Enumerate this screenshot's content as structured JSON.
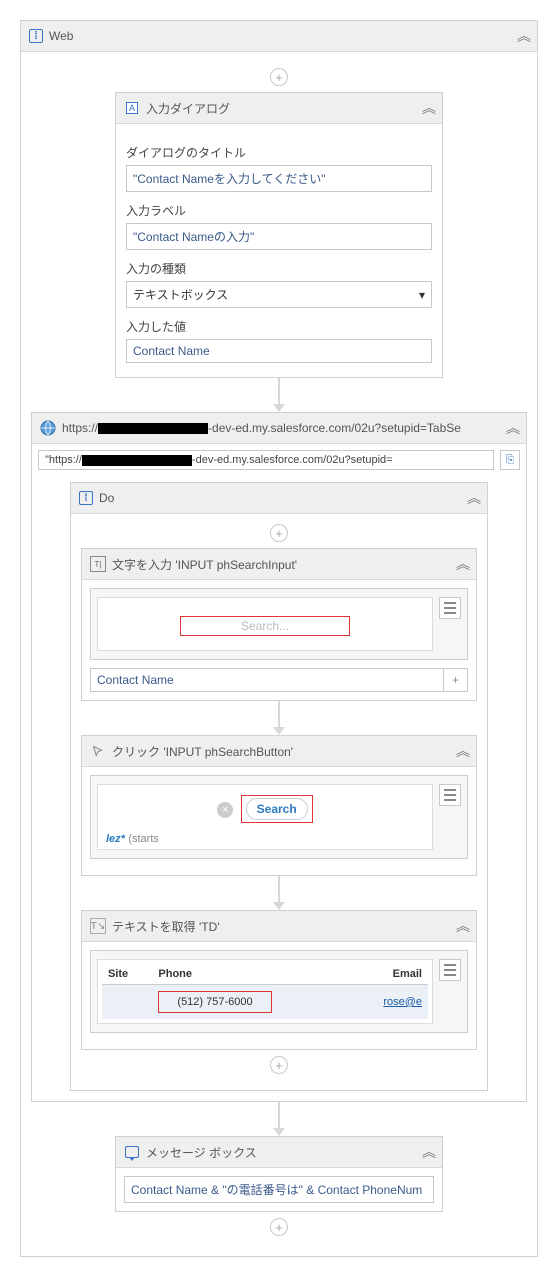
{
  "web": {
    "title": "Web"
  },
  "dialog": {
    "header": "入力ダイアログ",
    "title_label": "ダイアログのタイトル",
    "title_value": "\"Contact Nameを入力してください\"",
    "input_label_label": "入力ラベル",
    "input_label_value": "\"Contact Nameの入力\"",
    "type_label": "入力の種類",
    "type_value": "テキストボックス",
    "entered_label": "入力した値",
    "entered_value": "Contact Name"
  },
  "browser": {
    "header_prefix": "https://",
    "header_suffix": "-dev-ed.my.salesforce.com/02u?setupid=TabSe",
    "url_prefix": "\"https://",
    "url_suffix": "-dev-ed.my.salesforce.com/02u?setupid="
  },
  "do": {
    "title": "Do"
  },
  "typetext": {
    "header": "文字を入力 'INPUT  phSearchInput'",
    "placeholder": "Search...",
    "bound_value": "Contact Name"
  },
  "click": {
    "header": "クリック 'INPUT  phSearchButton'",
    "button_text": "Search",
    "wildcard": "lez*",
    "starts": "(starts"
  },
  "gettext": {
    "header": "テキストを取得 'TD'",
    "col_site": "Site",
    "col_phone": "Phone",
    "col_email": "Email",
    "val_phone": "(512) 757-6000",
    "val_email": "rose@e"
  },
  "msgbox": {
    "header": "メッセージ ボックス",
    "value": "Contact Name & \"の電話番号は\" & Contact PhoneNum"
  }
}
